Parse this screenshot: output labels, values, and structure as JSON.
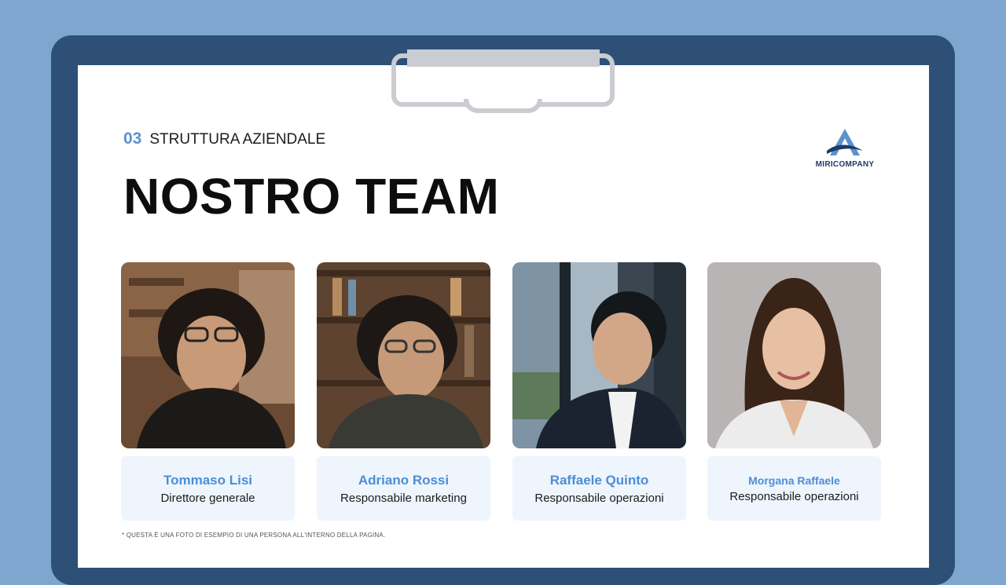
{
  "section": {
    "number": "03",
    "label": "STRUTTURA AZIENDALE"
  },
  "title": "NOSTRO TEAM",
  "logo": {
    "text": "MIRICOMPANY"
  },
  "team": [
    {
      "name": "Tommaso Lisi",
      "role": "Direttore generale"
    },
    {
      "name": "Adriano Rossi",
      "role": "Responsabile marketing"
    },
    {
      "name": "Raffaele Quinto",
      "role": "Responsabile operazioni"
    },
    {
      "name": "Morgana Raffaele",
      "role": "Responsabile operazioni"
    }
  ],
  "footnote": "* QUESTA È UNA FOTO DI ESEMPIO DI UNA PERSONA ALL'INTERNO DELLA PAGINA.",
  "colors": {
    "background": "#7fa6cf",
    "board": "#2e5077",
    "accent": "#5b93cf",
    "card": "#eef5fd"
  }
}
